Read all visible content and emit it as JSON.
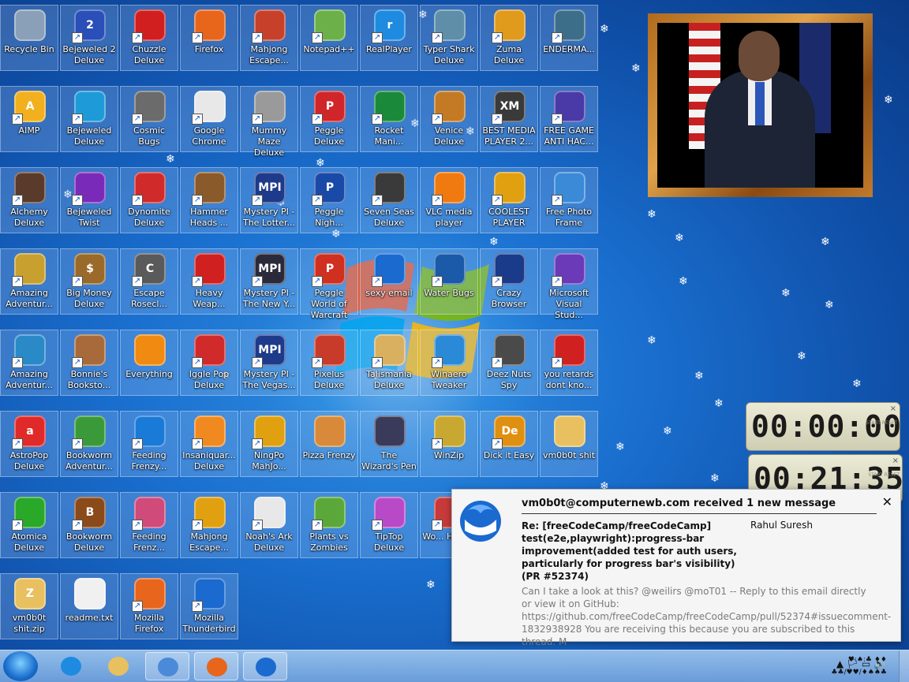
{
  "desktop": {
    "icons": [
      {
        "label": "Recycle Bin",
        "icon": "recycle-bin-icon",
        "color": "#8aa0b8",
        "glyph": "",
        "shortcut": false
      },
      {
        "label": "Bejeweled 2 Deluxe",
        "icon": "bejeweled-2-icon",
        "color": "#2a4fb8",
        "glyph": "2",
        "shortcut": true
      },
      {
        "label": "Chuzzle Deluxe",
        "icon": "chuzzle-icon",
        "color": "#d11f1f",
        "glyph": "",
        "shortcut": true
      },
      {
        "label": "Firefox",
        "icon": "firefox-icon",
        "color": "#e8651c",
        "glyph": "",
        "shortcut": true
      },
      {
        "label": "Mahjong Escape...",
        "icon": "mahjong-escape-icon",
        "color": "#c7402a",
        "glyph": "",
        "shortcut": true
      },
      {
        "label": "Notepad++",
        "icon": "notepad-plus-plus-icon",
        "color": "#6cb04a",
        "glyph": "",
        "shortcut": true
      },
      {
        "label": "RealPlayer",
        "icon": "realplayer-icon",
        "color": "#1e8be0",
        "glyph": "r",
        "shortcut": true
      },
      {
        "label": "Typer Shark Deluxe",
        "icon": "typer-shark-icon",
        "color": "#5e8ea8",
        "glyph": "",
        "shortcut": true
      },
      {
        "label": "Zuma Deluxe",
        "icon": "zuma-icon",
        "color": "#e09a1c",
        "glyph": "",
        "shortcut": true
      },
      {
        "label": "ENDERMA...",
        "icon": "enderman-icon",
        "color": "#3c6e8a",
        "glyph": "",
        "shortcut": true
      },
      {
        "label": "AIMP",
        "icon": "aimp-icon",
        "color": "#f2b01e",
        "glyph": "A",
        "shortcut": true
      },
      {
        "label": "Bejeweled Deluxe",
        "icon": "bejeweled-icon",
        "color": "#1e9ad8",
        "glyph": "",
        "shortcut": true
      },
      {
        "label": "Cosmic Bugs",
        "icon": "cosmic-bugs-icon",
        "color": "#6b6b6b",
        "glyph": "",
        "shortcut": true
      },
      {
        "label": "Google Chrome",
        "icon": "google-chrome-icon",
        "color": "#e8e8e8",
        "glyph": "",
        "shortcut": true
      },
      {
        "label": "Mummy Maze Deluxe",
        "icon": "mummy-maze-icon",
        "color": "#9a9a9a",
        "glyph": "",
        "shortcut": true
      },
      {
        "label": "Peggle Deluxe",
        "icon": "peggle-icon",
        "color": "#d0262a",
        "glyph": "P",
        "shortcut": true
      },
      {
        "label": "Rocket Mani...",
        "icon": "rocket-mania-icon",
        "color": "#1a8a3a",
        "glyph": "",
        "shortcut": true
      },
      {
        "label": "Venice Deluxe",
        "icon": "venice-icon",
        "color": "#c47a24",
        "glyph": "",
        "shortcut": true
      },
      {
        "label": "BEST MEDIA PLAYER 2...",
        "icon": "xm-play-icon",
        "color": "#3a3a3a",
        "glyph": "XM",
        "shortcut": true
      },
      {
        "label": "FREE GAME ANTI HAC...",
        "icon": "free-game-anti-hack-icon",
        "color": "#4a3aa8",
        "glyph": "",
        "shortcut": true
      },
      {
        "label": "Alchemy Deluxe",
        "icon": "alchemy-icon",
        "color": "#5a3a2a",
        "glyph": "",
        "shortcut": true
      },
      {
        "label": "Bejeweled Twist",
        "icon": "bejeweled-twist-icon",
        "color": "#7a2ab8",
        "glyph": "",
        "shortcut": true
      },
      {
        "label": "Dynomite Deluxe",
        "icon": "dynomite-icon",
        "color": "#d02a2a",
        "glyph": "",
        "shortcut": true
      },
      {
        "label": "Hammer Heads ...",
        "icon": "hammer-heads-icon",
        "color": "#8a5a2a",
        "glyph": "",
        "shortcut": true
      },
      {
        "label": "Mystery PI - The Lotter...",
        "icon": "mystery-pi-lottery-icon",
        "color": "#1e3a8a",
        "glyph": "MPI",
        "shortcut": true
      },
      {
        "label": "Peggle Nigh...",
        "icon": "peggle-nights-icon",
        "color": "#1a4aa8",
        "glyph": "P",
        "shortcut": true
      },
      {
        "label": "Seven Seas Deluxe",
        "icon": "seven-seas-icon",
        "color": "#3a3a3a",
        "glyph": "",
        "shortcut": true
      },
      {
        "label": "VLC media player",
        "icon": "vlc-icon",
        "color": "#f07a10",
        "glyph": "",
        "shortcut": true
      },
      {
        "label": "COOLEST PLAYER",
        "icon": "coolest-player-icon",
        "color": "#e0a010",
        "glyph": "",
        "shortcut": true
      },
      {
        "label": "Free Photo Frame",
        "icon": "photo-frame-icon",
        "color": "#3a8ad8",
        "glyph": "",
        "shortcut": true
      },
      {
        "label": "Amazing Adventur...",
        "icon": "amazing-adventures-icon",
        "color": "#c8a030",
        "glyph": "",
        "shortcut": true
      },
      {
        "label": "Big Money Deluxe",
        "icon": "big-money-icon",
        "color": "#9a6a2a",
        "glyph": "$",
        "shortcut": true
      },
      {
        "label": "Escape Rosecl...",
        "icon": "escape-rosecliff-icon",
        "color": "#5a5a5a",
        "glyph": "C",
        "shortcut": true
      },
      {
        "label": "Heavy Weap...",
        "icon": "heavy-weapon-icon",
        "color": "#d02020",
        "glyph": "",
        "shortcut": true
      },
      {
        "label": "Mystery PI - The New Y...",
        "icon": "mystery-pi-new-york-icon",
        "color": "#2a2a3a",
        "glyph": "MPI",
        "shortcut": true
      },
      {
        "label": "Peggle World of Warcraft",
        "icon": "peggle-wow-icon",
        "color": "#d03020",
        "glyph": "P",
        "shortcut": true
      },
      {
        "label": "sexy email",
        "icon": "thunderbird-icon",
        "color": "#1a6ad0",
        "glyph": "",
        "shortcut": true
      },
      {
        "label": "Water Bugs",
        "icon": "water-bugs-icon",
        "color": "#1a5aa8",
        "glyph": "",
        "shortcut": true
      },
      {
        "label": "Crazy Browser",
        "icon": "crazy-browser-icon",
        "color": "#1a3a8a",
        "glyph": "",
        "shortcut": true
      },
      {
        "label": "Microsoft Visual Stud...",
        "icon": "visual-studio-icon",
        "color": "#6a3ab8",
        "glyph": "",
        "shortcut": true
      },
      {
        "label": "Amazing Adventur...",
        "icon": "amazing-adventures-2-icon",
        "color": "#2a8ac8",
        "glyph": "",
        "shortcut": true
      },
      {
        "label": "Bonnie's Booksto...",
        "icon": "bonnies-bookstore-icon",
        "color": "#a86a3a",
        "glyph": "",
        "shortcut": true
      },
      {
        "label": "Everything",
        "icon": "everything-search-icon",
        "color": "#f08a10",
        "glyph": "",
        "shortcut": false
      },
      {
        "label": "Iggle Pop Deluxe",
        "icon": "iggle-pop-icon",
        "color": "#d02a2a",
        "glyph": "",
        "shortcut": true
      },
      {
        "label": "Mystery PI - The Vegas...",
        "icon": "mystery-pi-vegas-icon",
        "color": "#1e3a8a",
        "glyph": "MPI",
        "shortcut": true
      },
      {
        "label": "Pixelus Deluxe",
        "icon": "pixelus-icon",
        "color": "#c83a2a",
        "glyph": "",
        "shortcut": true
      },
      {
        "label": "Talismania Deluxe",
        "icon": "talismania-icon",
        "color": "#d8b060",
        "glyph": "",
        "shortcut": true
      },
      {
        "label": "Winaero Tweaker",
        "icon": "winaero-tweaker-icon",
        "color": "#2a8ad8",
        "glyph": "",
        "shortcut": true
      },
      {
        "label": "Deez Nuts Spy",
        "icon": "deez-nuts-spy-icon",
        "color": "#4a4a4a",
        "glyph": "",
        "shortcut": true
      },
      {
        "label": "you retards dont kno...",
        "icon": "you-retards-icon",
        "color": "#d02020",
        "glyph": "",
        "shortcut": true
      },
      {
        "label": "AstroPop Deluxe",
        "icon": "astropop-icon",
        "color": "#e02a2a",
        "glyph": "a",
        "shortcut": true
      },
      {
        "label": "Bookworm Adventur...",
        "icon": "bookworm-adventures-icon",
        "color": "#3a9a3a",
        "glyph": "",
        "shortcut": true
      },
      {
        "label": "Feeding Frenzy...",
        "icon": "feeding-frenzy-icon",
        "color": "#1a7ad8",
        "glyph": "",
        "shortcut": true
      },
      {
        "label": "Insaniquar... Deluxe",
        "icon": "insaniquarium-icon",
        "color": "#f08a20",
        "glyph": "",
        "shortcut": true
      },
      {
        "label": "NingPo MahJo...",
        "icon": "ningpo-mahjong-icon",
        "color": "#e0a010",
        "glyph": "",
        "shortcut": true
      },
      {
        "label": "Pizza Frenzy",
        "icon": "pizza-frenzy-icon",
        "color": "#d88a3a",
        "glyph": "",
        "shortcut": false
      },
      {
        "label": "The Wizard's Pen",
        "icon": "wizards-pen-icon",
        "color": "#3a3a5a",
        "glyph": "",
        "shortcut": false
      },
      {
        "label": "WinZip",
        "icon": "winzip-icon",
        "color": "#c8a830",
        "glyph": "",
        "shortcut": true
      },
      {
        "label": "Dick it Easy",
        "icon": "dick-it-easy-icon",
        "color": "#e09010",
        "glyph": "De",
        "shortcut": true
      },
      {
        "label": "vm0b0t shit",
        "icon": "folder-icon",
        "color": "#e8c060",
        "glyph": "",
        "shortcut": false
      },
      {
        "label": "Atomica Deluxe",
        "icon": "atomica-icon",
        "color": "#2aa82a",
        "glyph": "",
        "shortcut": true
      },
      {
        "label": "Bookworm Deluxe",
        "icon": "bookworm-icon",
        "color": "#8a4a1a",
        "glyph": "B",
        "shortcut": true
      },
      {
        "label": "Feeding Frenz...",
        "icon": "feeding-frenzy-2-icon",
        "color": "#d04a7a",
        "glyph": "",
        "shortcut": true
      },
      {
        "label": "Mahjong Escape...",
        "icon": "mahjong-escape-2-icon",
        "color": "#e0a010",
        "glyph": "",
        "shortcut": true
      },
      {
        "label": "Noah's Ark Deluxe",
        "icon": "noahs-ark-icon",
        "color": "#e8e8e8",
        "glyph": "",
        "shortcut": true
      },
      {
        "label": "Plants vs Zombies",
        "icon": "plants-vs-zombies-icon",
        "color": "#5aa83a",
        "glyph": "",
        "shortcut": true
      },
      {
        "label": "TipTop Deluxe",
        "icon": "tiptop-icon",
        "color": "#b84ac8",
        "glyph": "",
        "shortcut": true
      },
      {
        "label": "Wo... Harn...",
        "icon": "unknown-game-icon",
        "color": "#c83a3a",
        "glyph": "",
        "shortcut": true
      },
      {
        "label": "vm0b0t shit.zip",
        "icon": "zip-folder-icon",
        "color": "#e8c060",
        "glyph": "Z",
        "shortcut": false
      },
      {
        "label": "readme.txt",
        "icon": "text-file-icon",
        "color": "#f0f0f0",
        "glyph": "",
        "shortcut": false
      },
      {
        "label": "Mozilla Firefox",
        "icon": "mozilla-firefox-icon",
        "color": "#e8651c",
        "glyph": "",
        "shortcut": true
      },
      {
        "label": "Mozilla Thunderbird",
        "icon": "mozilla-thunderbird-icon",
        "color": "#1a6ad0",
        "glyph": "",
        "shortcut": true
      }
    ]
  },
  "gadgets": {
    "timer1": {
      "digits": "00:00:00",
      "close": "×",
      "side": "START RESET"
    },
    "timer2": {
      "digits": "00:21:35",
      "close": "×",
      "side": "START RESET"
    }
  },
  "notification": {
    "header": "vm0b0t@computernewb.com received 1 new message",
    "close": "✕",
    "subject": "Re: [freeCodeCamp/freeCodeCamp] test(e2e,playwright):progress-bar improvement(added test for auth users, particularly for progress bar's visibility) (PR #52374)",
    "sender": "Rahul Suresh",
    "preview": "Can I take a look at this? @weilirs @moT01 -- Reply to this email directly or view it on GitHub: https://github.com/freeCodeCamp/freeCodeCamp/pull/52374#issuecomment-1832938928 You are receiving this because you are subscribed to this thread. M"
  },
  "taskbar": {
    "buttons": [
      {
        "name": "internet-explorer",
        "icon": "internet-explorer-icon",
        "color": "#1e8be0",
        "open": false
      },
      {
        "name": "file-explorer",
        "icon": "folder-icon",
        "color": "#e8c060",
        "open": false
      },
      {
        "name": "chrome",
        "icon": "google-chrome-icon",
        "color": "#4a8ad8",
        "open": true
      },
      {
        "name": "firefox",
        "icon": "firefox-icon",
        "color": "#e8651c",
        "open": true
      },
      {
        "name": "thunderbird",
        "icon": "thunderbird-icon",
        "color": "#1a6ad0",
        "open": true
      }
    ],
    "tray": "▲ 🏳 ▭ 🔊",
    "clock_line1": "♥:♠:♣ ♦♦",
    "clock_line2": "♣♣/♥♥/♦♠♠♣"
  }
}
